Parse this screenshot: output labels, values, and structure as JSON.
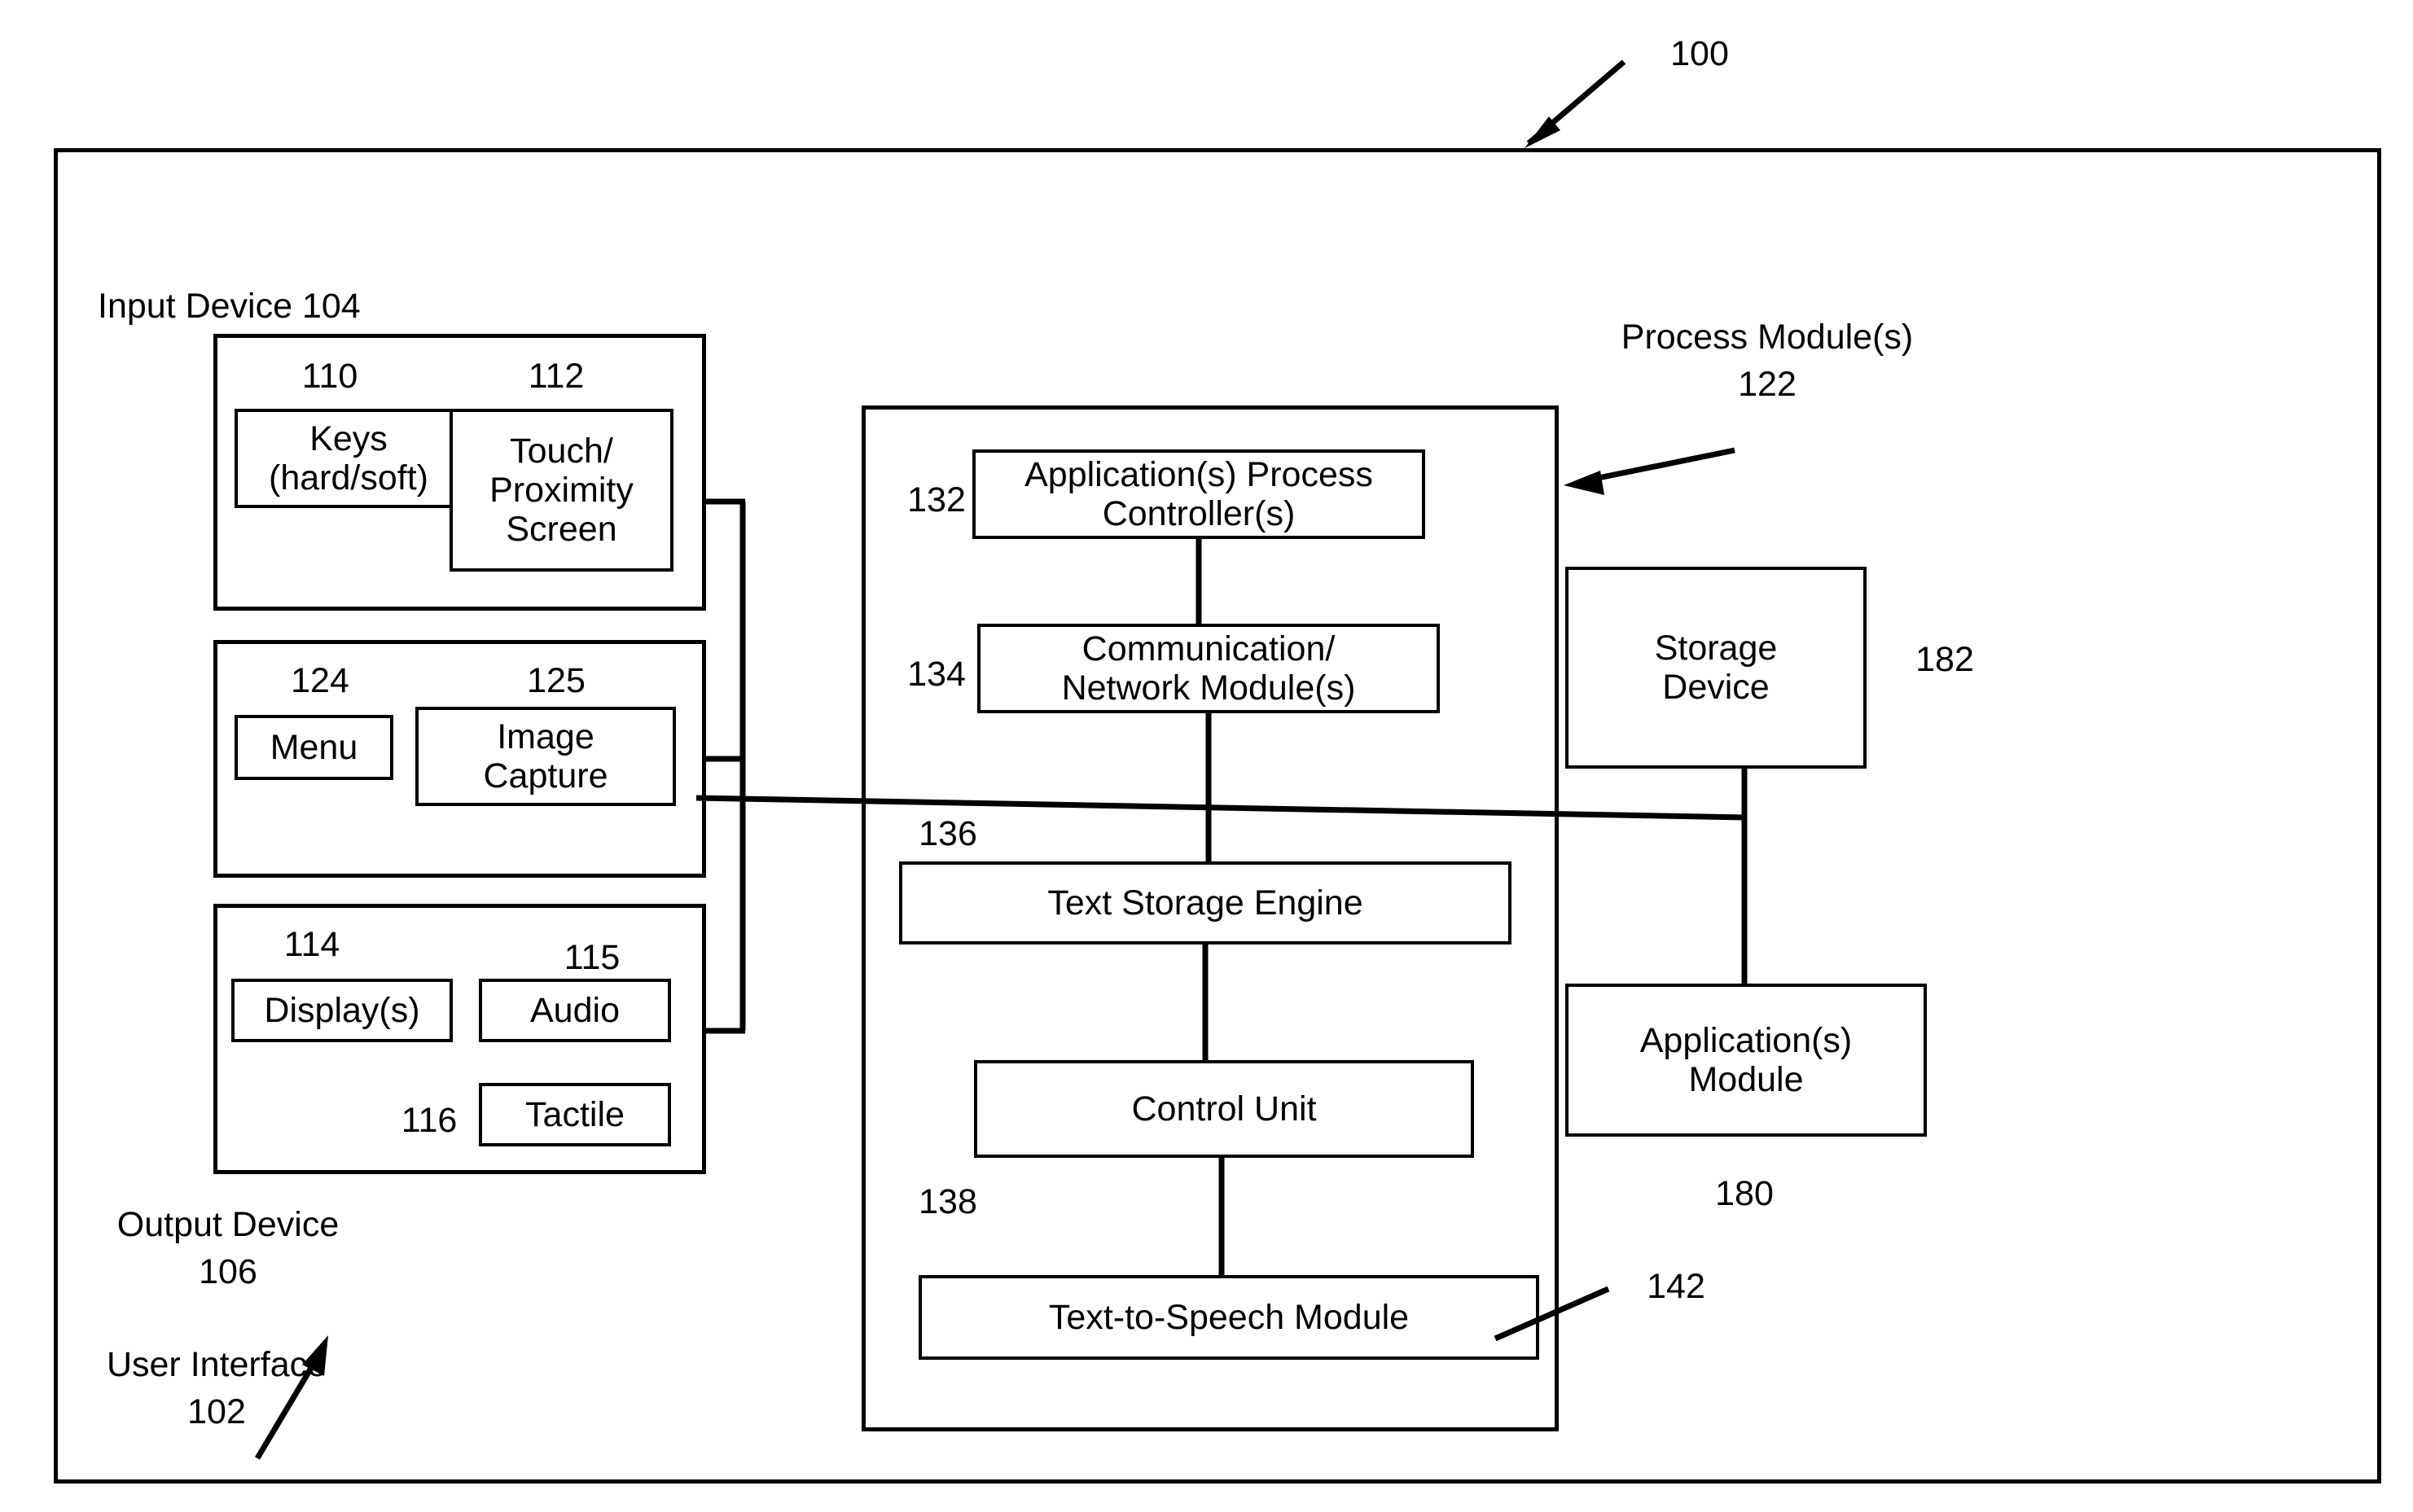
{
  "figure": {
    "system_ref": "100",
    "outer_label_top_right": "100"
  },
  "labels": {
    "input_device": "Input Device 104",
    "process_module_line1": "Process Module(s)",
    "process_module_line2": "122",
    "output_device_line1": "Output Device",
    "output_device_line2": "106",
    "user_interface_line1": "User Interface",
    "user_interface_line2": "102",
    "storage_device_ref": "182",
    "applications_module_ref": "180",
    "text_to_speech_ref": "142"
  },
  "input_group_1": {
    "ref_left": "110",
    "ref_right": "112",
    "keys_line1": "Keys",
    "keys_line2": "(hard/soft)",
    "touch_line1": "Touch/",
    "touch_line2": "Proximity",
    "touch_line3": "Screen"
  },
  "input_group_2": {
    "ref_left": "124",
    "ref_right": "125",
    "menu": "Menu",
    "image_capture_line1": "Image",
    "image_capture_line2": "Capture"
  },
  "output_group": {
    "ref_display": "114",
    "ref_audio": "115",
    "ref_tactile": "116",
    "display": "Display(s)",
    "audio": "Audio",
    "tactile": "Tactile"
  },
  "process_module": {
    "ref_app_controller": "132",
    "app_controller_line1": "Application(s) Process",
    "app_controller_line2": "Controller(s)",
    "ref_comm": "134",
    "comm_line1": "Communication/",
    "comm_line2": "Network Module(s)",
    "ref_text_storage": "136",
    "text_storage": "Text Storage Engine",
    "ref_control_unit": "138",
    "control_unit": "Control Unit",
    "text_to_speech": "Text-to-Speech Module"
  },
  "right_column": {
    "storage_line1": "Storage",
    "storage_line2": "Device",
    "applications_line1": "Application(s)",
    "applications_line2": "Module"
  },
  "colors": {
    "ink": "#000000",
    "paper": "#ffffff"
  }
}
